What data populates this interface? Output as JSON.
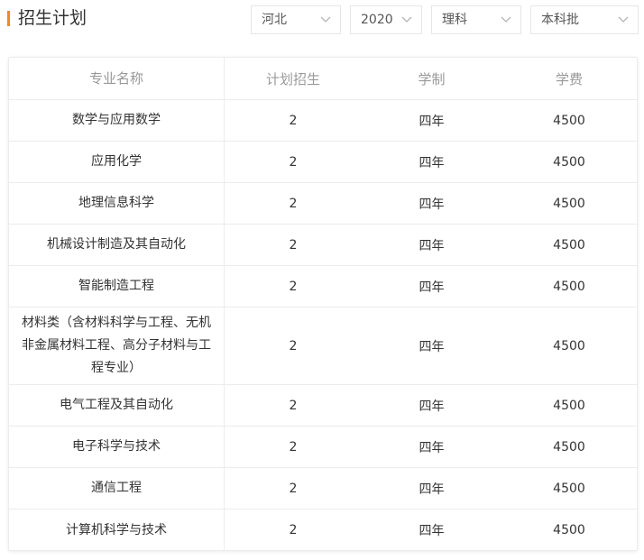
{
  "header": {
    "title": "招生计划"
  },
  "filters": [
    {
      "value": "河北",
      "icon": "chevron-down-icon"
    },
    {
      "value": "2020",
      "icon": "chevron-down-icon"
    },
    {
      "value": "理科",
      "icon": "chevron-down-icon"
    },
    {
      "value": "本科批",
      "icon": "chevron-down-icon"
    }
  ],
  "table": {
    "columns": [
      "专业名称",
      "计划招生",
      "学制",
      "学费"
    ],
    "rows": [
      {
        "major": "数学与应用数学",
        "plan": "2",
        "duration": "四年",
        "fee": "4500"
      },
      {
        "major": "应用化学",
        "plan": "2",
        "duration": "四年",
        "fee": "4500"
      },
      {
        "major": "地理信息科学",
        "plan": "2",
        "duration": "四年",
        "fee": "4500"
      },
      {
        "major": "机械设计制造及其自动化",
        "plan": "2",
        "duration": "四年",
        "fee": "4500"
      },
      {
        "major": "智能制造工程",
        "plan": "2",
        "duration": "四年",
        "fee": "4500"
      },
      {
        "major": "材料类（含材料科学与工程、无机非金属材料工程、高分子材料与工程专业）",
        "plan": "2",
        "duration": "四年",
        "fee": "4500"
      },
      {
        "major": "电气工程及其自动化",
        "plan": "2",
        "duration": "四年",
        "fee": "4500"
      },
      {
        "major": "电子科学与技术",
        "plan": "2",
        "duration": "四年",
        "fee": "4500"
      },
      {
        "major": "通信工程",
        "plan": "2",
        "duration": "四年",
        "fee": "4500"
      },
      {
        "major": "计算机科学与技术",
        "plan": "2",
        "duration": "四年",
        "fee": "4500"
      }
    ]
  },
  "colors": {
    "accent": "#f08a24",
    "border": "#ececec",
    "header_text": "#999999",
    "body_text": "#333333"
  }
}
